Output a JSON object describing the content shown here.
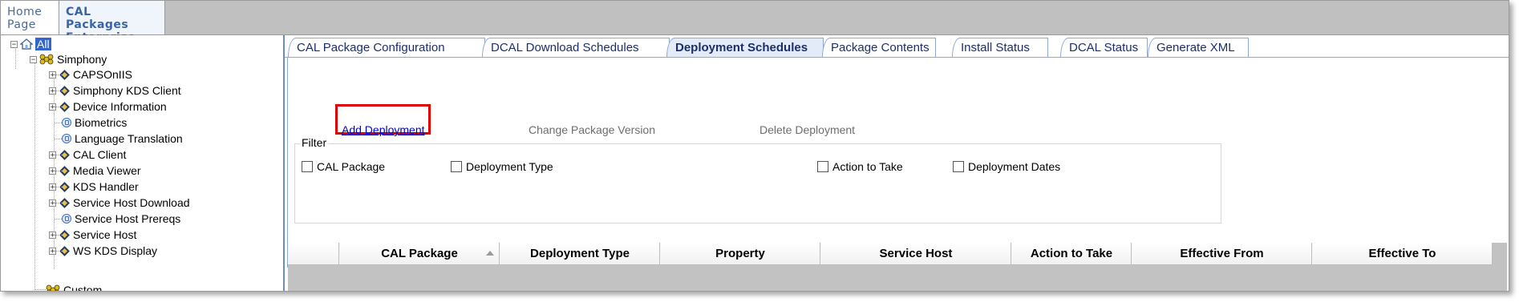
{
  "top_nav": {
    "home": "Home\nPage",
    "home_line1": "Home",
    "home_line2": "Page",
    "cal_line1": "CAL Packages",
    "cal_line2": "Enterprise"
  },
  "tree": {
    "root": "All",
    "simphony": "Simphony",
    "items": [
      {
        "label": "CAPSOnIIS",
        "type": "folder"
      },
      {
        "label": "Simphony KDS Client",
        "type": "folder"
      },
      {
        "label": "Device Information",
        "type": "folder"
      },
      {
        "label": "Biometrics",
        "type": "leaf"
      },
      {
        "label": "Language Translation",
        "type": "leaf"
      },
      {
        "label": "CAL Client",
        "type": "folder"
      },
      {
        "label": "Media Viewer",
        "type": "folder"
      },
      {
        "label": "KDS Handler",
        "type": "folder"
      },
      {
        "label": "Service Host Download",
        "type": "folder"
      },
      {
        "label": "Service Host Prereqs",
        "type": "leaf"
      },
      {
        "label": "Service Host",
        "type": "folder"
      },
      {
        "label": "WS KDS Display",
        "type": "folder"
      }
    ],
    "custom": "Custom"
  },
  "tabs": [
    {
      "label": "CAL Package Configuration"
    },
    {
      "label": "DCAL Download Schedules"
    },
    {
      "label": "Deployment Schedules",
      "active": true
    },
    {
      "label": "Package Contents"
    },
    {
      "label": "Install Status"
    },
    {
      "label": "DCAL Status"
    },
    {
      "label": "Generate XML"
    }
  ],
  "actions": {
    "add": "Add Deployment",
    "change": "Change Package Version",
    "delete": "Delete Deployment"
  },
  "filter": {
    "legend": "Filter",
    "options": [
      "CAL Package",
      "Deployment Type",
      "Action to Take",
      "Deployment Dates"
    ]
  },
  "grid": {
    "columns": [
      "CAL Package",
      "Deployment Type",
      "Property",
      "Service Host",
      "Action to Take",
      "Effective From",
      "Effective To"
    ]
  },
  "colors": {
    "highlight_box": "#e00000",
    "link": "#0000cc",
    "active_tab_bg": "#e3ebf8"
  }
}
